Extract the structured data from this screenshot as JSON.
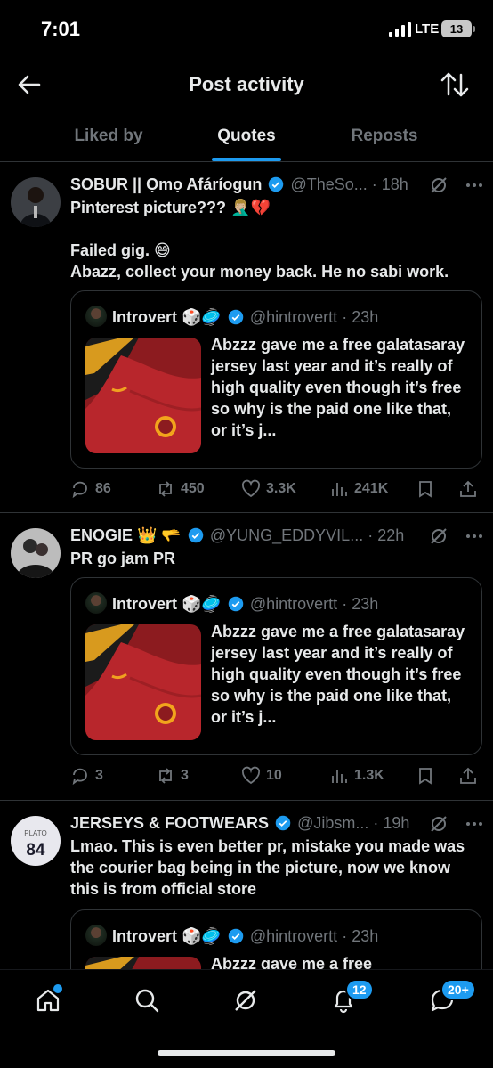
{
  "status_bar": {
    "time": "7:01",
    "network": "LTE",
    "battery": "13"
  },
  "header": {
    "title": "Post activity"
  },
  "tabs": [
    {
      "label": "Liked by"
    },
    {
      "label": "Quotes"
    },
    {
      "label": "Reposts"
    }
  ],
  "active_tab": "Quotes",
  "accent_color": "#1d9bf0",
  "posts": [
    {
      "name": "SOBUR || Ọmọ Afáríogun",
      "handle": "@TheSo...",
      "time": "· 18h",
      "text": "Pinterest picture??? 🤦🏼‍♂️💔\n\nFailed gig. 😅\nAbazz, collect your money back. He no sabi work.",
      "quote": {
        "name": "Introvert 🎲🥏",
        "handle": "@hintrovertt",
        "time": "· 23h",
        "text": "Abzzz gave me a free galatasaray jersey last year and it’s really of high quality even though it’s free so why is the paid one like that, or it’s j..."
      },
      "stats": {
        "replies": "86",
        "reposts": "450",
        "likes": "3.3K",
        "views": "241K"
      }
    },
    {
      "name": "ENOGIE 👑 🫳",
      "handle": "@YUNG_EDDYVIL...",
      "time": "· 22h",
      "text": "PR go jam PR",
      "quote": {
        "name": "Introvert 🎲🥏",
        "handle": "@hintrovertt",
        "time": "· 23h",
        "text": "Abzzz gave me a free galatasaray jersey last year and it’s really of high quality even though it’s free so why is the paid one like that, or it’s j..."
      },
      "stats": {
        "replies": "3",
        "reposts": "3",
        "likes": "10",
        "views": "1.3K"
      }
    },
    {
      "name": "JERSEYS & FOOTWEARS",
      "handle": "@Jibsm...",
      "time": "· 19h",
      "text": "Lmao. This is even better pr, mistake you made was the courier bag being in the picture, now we know this is from official store",
      "avatar_jersey_name": "PLATO",
      "avatar_jersey_number": "84",
      "quote": {
        "name": "Introvert 🎲🥏",
        "handle": "@hintrovertt",
        "time": "· 23h",
        "text": "Abzzz gave me a free"
      }
    }
  ],
  "tab_bar": {
    "notifications_badge": "12",
    "messages_badge": "20+"
  }
}
